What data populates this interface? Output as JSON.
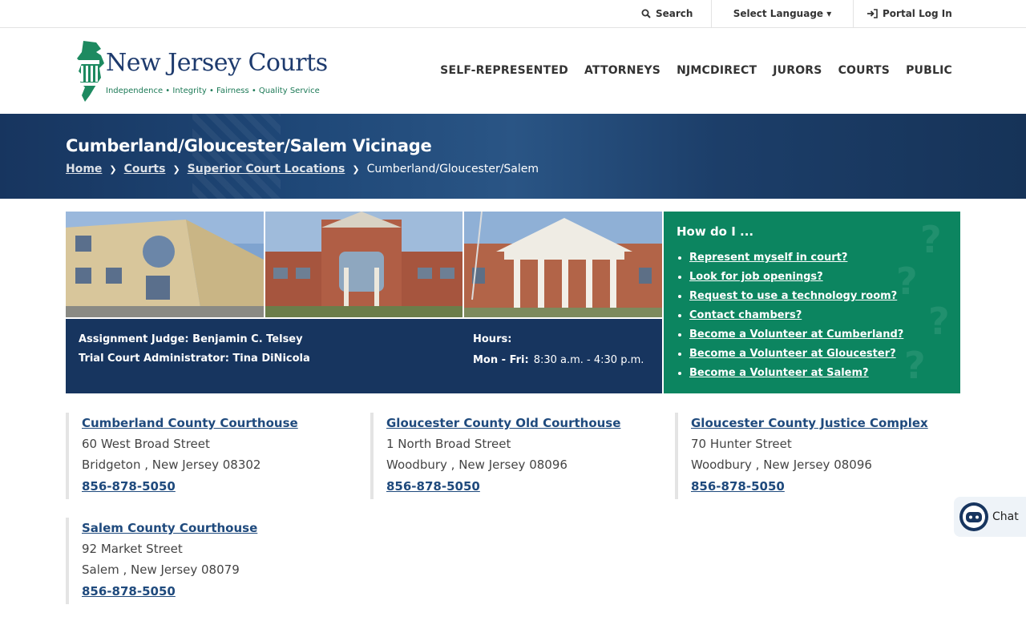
{
  "utility": {
    "search": "Search",
    "language": "Select Language ▾",
    "login": "Portal Log In"
  },
  "logo": {
    "title": "New Jersey Courts",
    "tagline": "Independence • Integrity • Fairness • Quality Service"
  },
  "nav": [
    "SELF-REPRESENTED",
    "ATTORNEYS",
    "NJMCDIRECT",
    "JURORS",
    "COURTS",
    "PUBLIC"
  ],
  "banner": {
    "title": "Cumberland/Gloucester/Salem Vicinage",
    "breadcrumb": [
      "Home",
      "Courts",
      "Superior Court Locations"
    ],
    "current": "Cumberland/Gloucester/Salem"
  },
  "info": {
    "judge": "Assignment Judge: Benjamin C. Telsey",
    "admin": "Trial Court Administrator: Tina DiNicola",
    "hours_label": "Hours:",
    "hours_days": "Mon - Fri:",
    "hours_time": "8:30 a.m. - 4:30 p.m."
  },
  "howdo": {
    "title": "How do I ...",
    "items": [
      "Represent myself in court?",
      "Look for job openings?",
      "Request to use a technology room?",
      "Contact chambers?",
      "Become a Volunteer at Cumberland?",
      "Become a Volunteer at Gloucester?",
      "Become a Volunteer at Salem?"
    ]
  },
  "locations": [
    {
      "name": "Cumberland County Courthouse",
      "street": "60 West Broad Street",
      "city": "Bridgeton , New Jersey 08302",
      "phone": "856-878-5050"
    },
    {
      "name": "Gloucester County Old Courthouse",
      "street": "1 North Broad Street",
      "city": "Woodbury , New Jersey 08096",
      "phone": "856-878-5050"
    },
    {
      "name": "Gloucester County Justice Complex",
      "street": "70 Hunter Street",
      "city": "Woodbury , New Jersey 08096",
      "phone": "856-878-5050"
    },
    {
      "name": "Salem County Courthouse",
      "street": "92 Market Street",
      "city": "Salem , New Jersey 08079",
      "phone": "856-878-5050"
    }
  ],
  "chat": {
    "label": "Chat"
  },
  "colors": {
    "navy": "#17355f",
    "green": "#0c8560",
    "link": "#1f4a7d"
  }
}
